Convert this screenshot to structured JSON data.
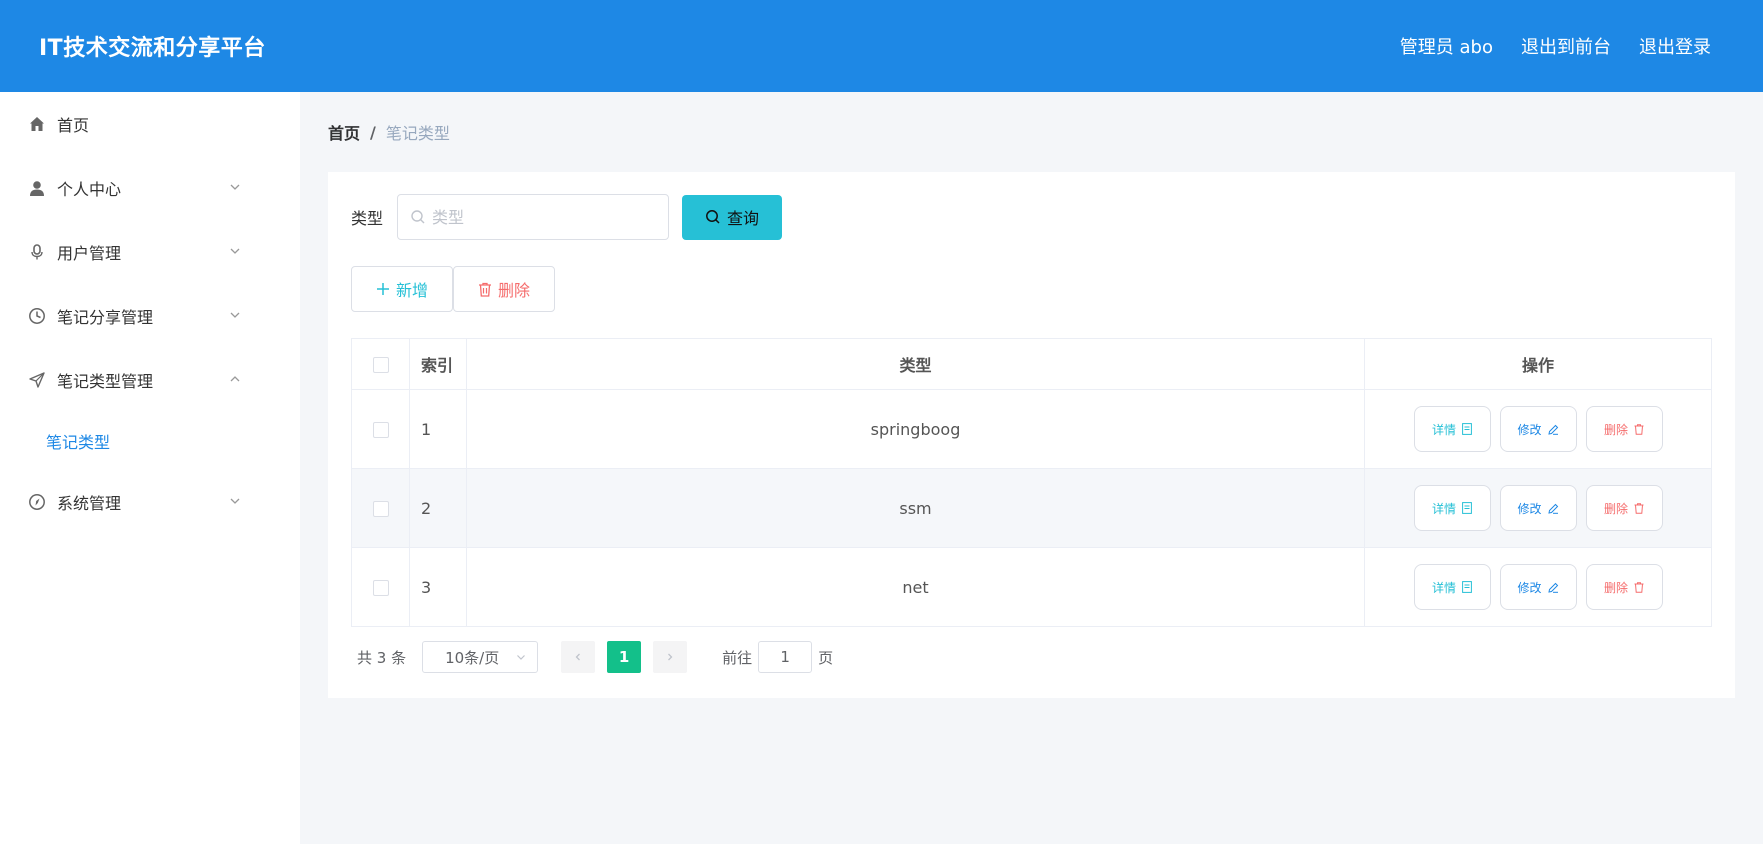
{
  "header": {
    "title": "IT技术交流和分享平台",
    "user": "管理员 abo",
    "to_front": "退出到前台",
    "logout": "退出登录",
    "bg_color": "#1e88e5"
  },
  "sidebar": {
    "items": [
      {
        "label": "首页",
        "icon": "home-icon"
      },
      {
        "label": "个人中心",
        "icon": "user-icon"
      },
      {
        "label": "用户管理",
        "icon": "microphone-icon"
      },
      {
        "label": "笔记分享管理",
        "icon": "clock-icon"
      },
      {
        "label": "笔记类型管理",
        "icon": "send-icon"
      },
      {
        "label": "系统管理",
        "icon": "compass-icon"
      }
    ],
    "submenu": {
      "label": "笔记类型"
    }
  },
  "breadcrumb": {
    "home": "首页",
    "sep": "/",
    "current": "笔记类型"
  },
  "search": {
    "label": "类型",
    "placeholder": "类型",
    "button": "查询"
  },
  "actions": {
    "add": "新增",
    "delete": "删除"
  },
  "table": {
    "headers": {
      "index": "索引",
      "type": "类型",
      "ops": "操作"
    },
    "rows": [
      {
        "index": "1",
        "type": "springboog"
      },
      {
        "index": "2",
        "type": "ssm"
      },
      {
        "index": "3",
        "type": "net"
      }
    ],
    "op_labels": {
      "detail": "详情",
      "edit": "修改",
      "delete": "删除"
    }
  },
  "pagination": {
    "total": "共 3 条",
    "page_size": "10条/页",
    "current_page": "1",
    "goto_label": "前往",
    "goto_value": "1",
    "page_suffix": "页",
    "active_color": "#13c08a"
  }
}
